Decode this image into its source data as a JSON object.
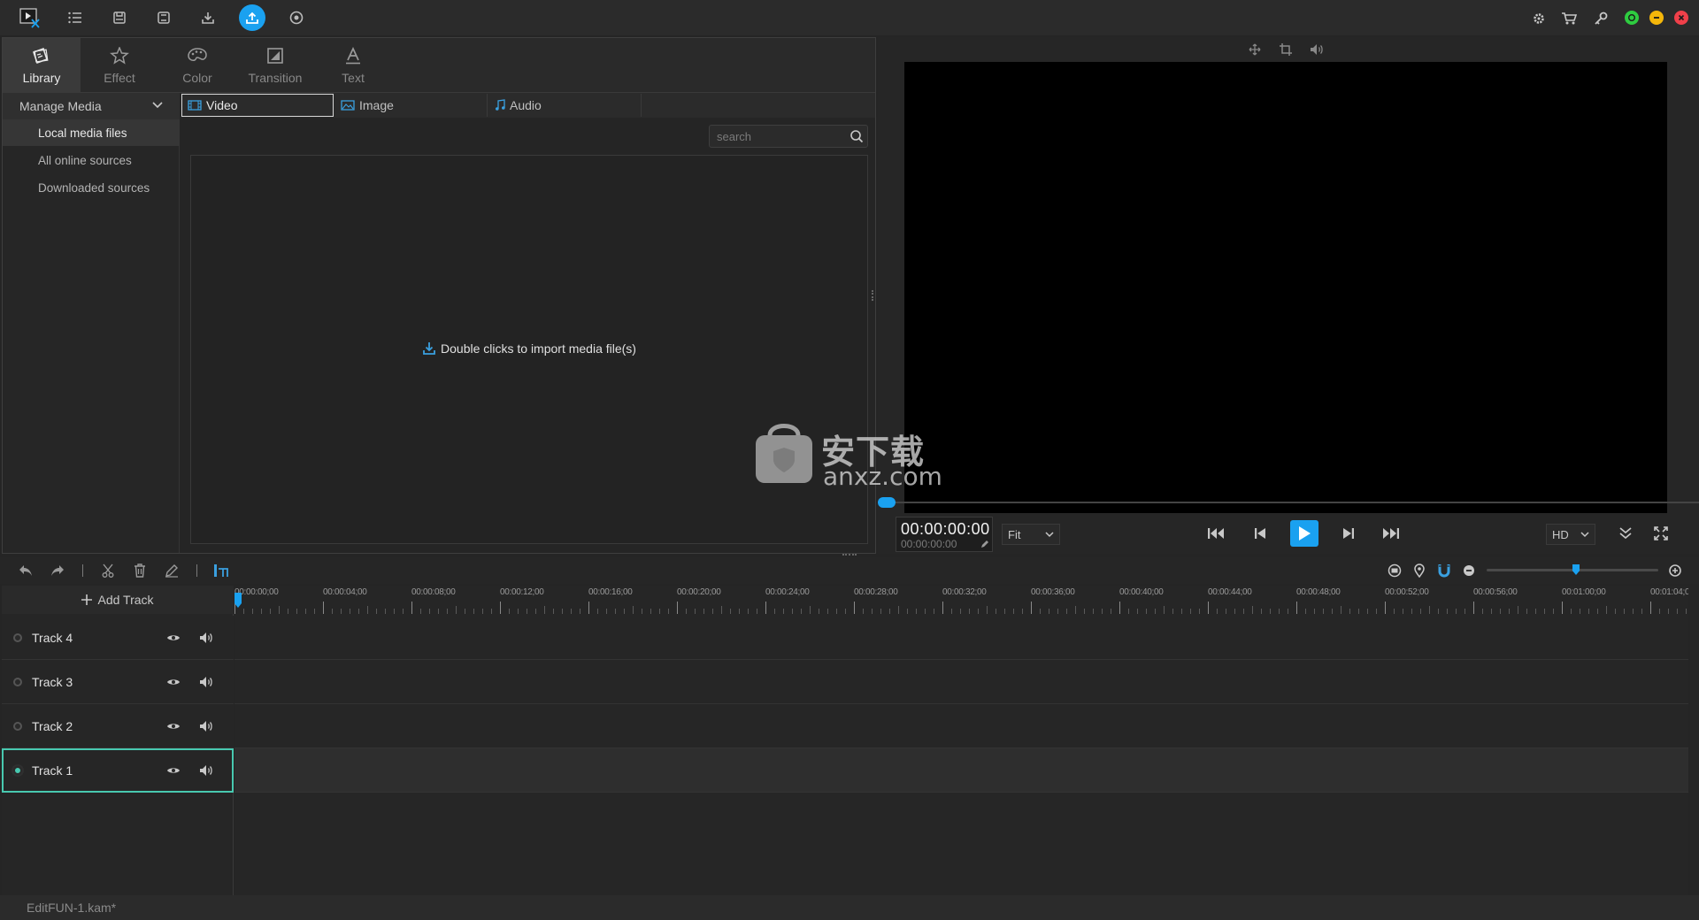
{
  "titlebar": {
    "icons": [
      "app-logo-icon",
      "menu-icon",
      "save-icon",
      "save-as-icon",
      "download-icon",
      "export-icon",
      "record-icon"
    ],
    "right_icons": [
      "settings-icon",
      "cart-icon",
      "key-icon"
    ],
    "window_controls": [
      "maximize-button",
      "minimize-button",
      "close-button"
    ],
    "accent": "#1aa1f0"
  },
  "main_tabs": [
    {
      "label": "Library",
      "icon": "library-icon"
    },
    {
      "label": "Effect",
      "icon": "effect-icon"
    },
    {
      "label": "Color",
      "icon": "palette-icon"
    },
    {
      "label": "Transition",
      "icon": "transition-icon"
    },
    {
      "label": "Text",
      "icon": "text-icon"
    }
  ],
  "sidebar": {
    "header": "Manage Media",
    "items": [
      {
        "label": "Local media files"
      },
      {
        "label": "All online sources"
      },
      {
        "label": "Downloaded sources"
      }
    ]
  },
  "sub_tabs": [
    {
      "label": "Video",
      "icon": "video-icon"
    },
    {
      "label": "Image",
      "icon": "image-icon"
    },
    {
      "label": "Audio",
      "icon": "music-icon"
    }
  ],
  "search": {
    "placeholder": "search"
  },
  "import_hint": "Double clicks to import media file(s)",
  "preview": {
    "timecode": "00:00:00:00",
    "timecode_sub": "00:00:00:00",
    "fit_option": "Fit",
    "quality_option": "HD"
  },
  "timeline": {
    "add_track_label": "Add Track",
    "ruler_labels": [
      "00:00:00;00",
      "00:00:04;00",
      "00:00:08;00",
      "00:00:12;00",
      "00:00:16;00",
      "00:00:20;00",
      "00:00:24;00",
      "00:00:28;00",
      "00:00:32;00",
      "00:00:36;00",
      "00:00:40;00",
      "00:00:44;00",
      "00:00:48;00",
      "00:00:52;00",
      "00:00:56;00",
      "00:01:00;00",
      "00:01:04;0"
    ],
    "tracks": [
      {
        "name": "Track 4"
      },
      {
        "name": "Track 3"
      },
      {
        "name": "Track 2"
      },
      {
        "name": "Track 1"
      }
    ],
    "active_track_color": "#48c9b0"
  },
  "status": {
    "project_name": "EditFUN-1.kam*"
  },
  "watermark": {
    "text": "安下载",
    "sub": "anxz.com"
  }
}
